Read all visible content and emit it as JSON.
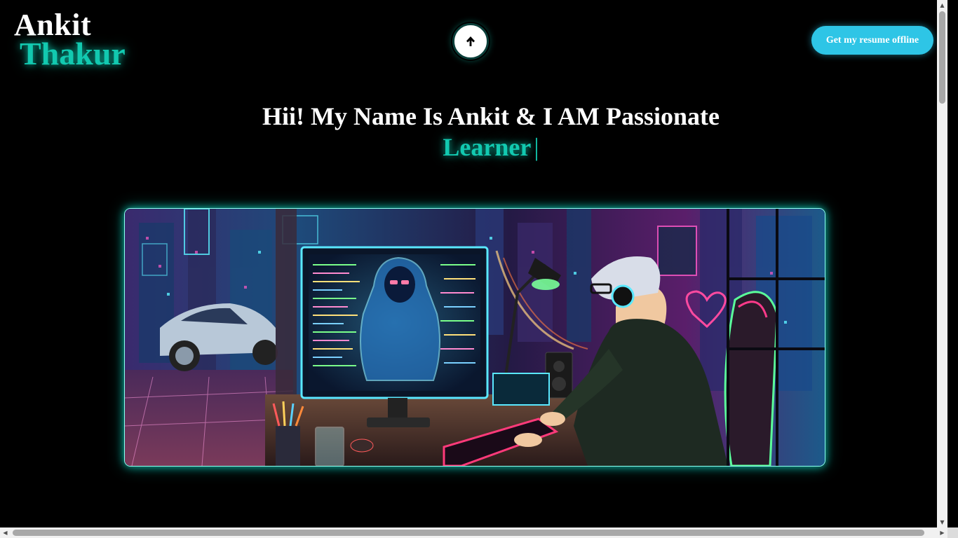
{
  "header": {
    "logo_first": "Ankit",
    "logo_last": "Thakur",
    "scroll_top_icon": "arrow-up-icon",
    "resume_button_label": "Get my resume offline"
  },
  "hero": {
    "headline": "Hii! My Name Is Ankit & I AM Passionate",
    "role": "Learner",
    "cursor": "|"
  },
  "banner": {
    "image_subject": "neon cyberpunk coding workspace illustration"
  },
  "colors": {
    "background": "#000000",
    "accent_teal": "#12c9b0",
    "button_cyan": "#2ec5e6",
    "text_white": "#ffffff"
  }
}
